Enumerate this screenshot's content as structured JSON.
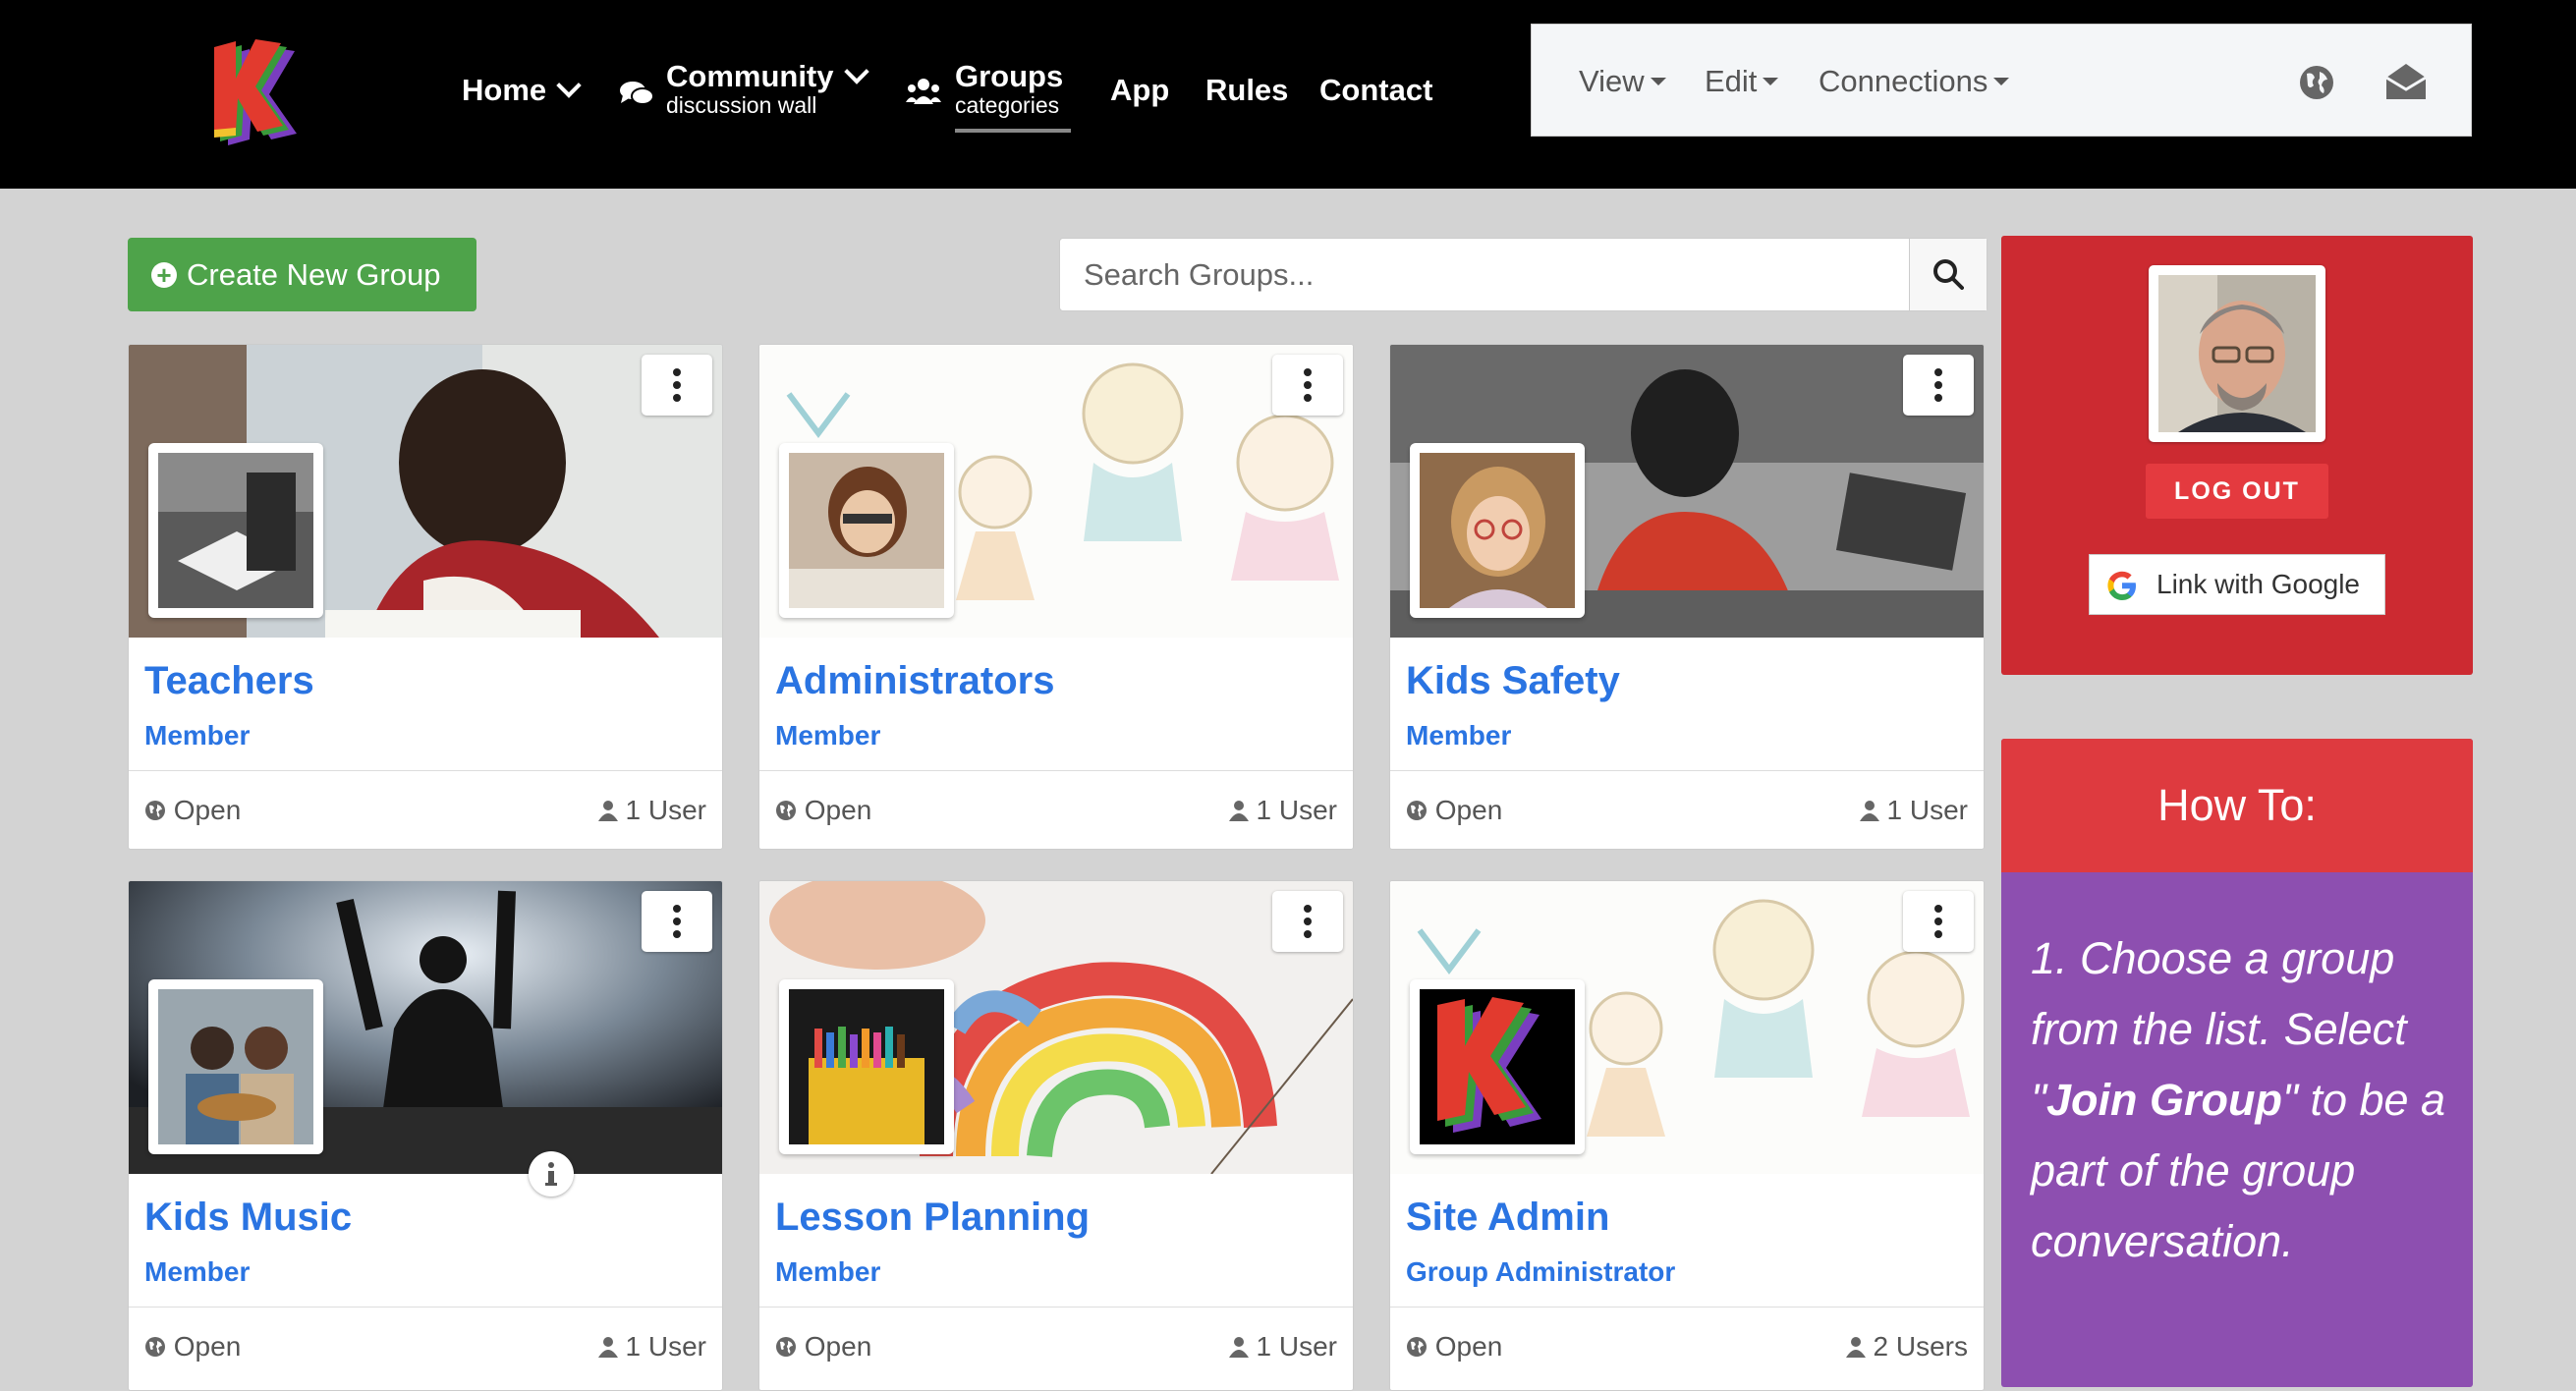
{
  "brand": {
    "logo_letter": "K"
  },
  "nav": {
    "home": "Home",
    "community": "Community",
    "community_sub": "discussion wall",
    "groups": "Groups",
    "groups_sub": "categories",
    "app": "App",
    "rules": "Rules",
    "contact": "Contact"
  },
  "userbar": {
    "view": "View",
    "edit": "Edit",
    "connections": "Connections",
    "icons": [
      "globe-icon",
      "envelope-open-icon"
    ]
  },
  "toolbar": {
    "create_label": "Create New Group",
    "search_placeholder": "Search Groups...",
    "search_value": ""
  },
  "groups": [
    {
      "title": "Teachers",
      "role": "Member",
      "status": "Open",
      "users": "1 User"
    },
    {
      "title": "Administrators",
      "role": "Member",
      "status": "Open",
      "users": "1 User"
    },
    {
      "title": "Kids Safety",
      "role": "Member",
      "status": "Open",
      "users": "1 User"
    },
    {
      "title": "Kids Music",
      "role": "Member",
      "status": "Open",
      "users": "1 User"
    },
    {
      "title": "Lesson Planning",
      "role": "Member",
      "status": "Open",
      "users": "1 User"
    },
    {
      "title": "Site Admin",
      "role": "Group Administrator",
      "status": "Open",
      "users": "2 Users"
    }
  ],
  "profile": {
    "logout_label": "LOG OUT",
    "google_label": "Link with Google"
  },
  "howto": {
    "heading": "How To:",
    "step_prefix": "1. Choose a group from the list. Select \"",
    "step_bold": "Join Group",
    "step_suffix": "\" to be a part of the group conversation."
  },
  "colors": {
    "header_bg": "#000000",
    "page_bg": "#d3d3d3",
    "create_button": "#4ea34a",
    "link_blue": "#2a74e2",
    "profile_red": "#cc2a31",
    "howto_purple": "#8d4fb0"
  }
}
